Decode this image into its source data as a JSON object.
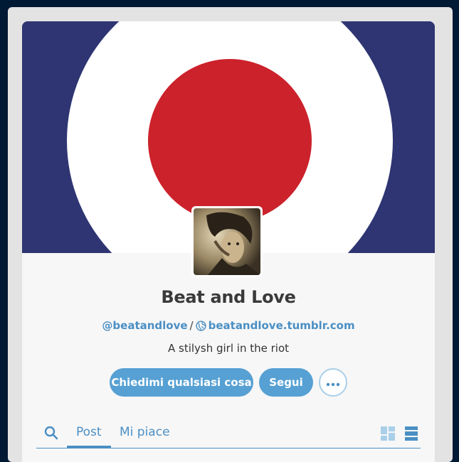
{
  "blog": {
    "title": "Beat and Love",
    "username": "@beatandlove",
    "separator": "/",
    "url": "beatandlove.tumblr.com",
    "description": "A stilysh girl in the riot"
  },
  "actions": {
    "ask_label": "Chiedimi qualsiasi cosa",
    "follow_label": "Segui",
    "more_icon": "ellipsis-icon"
  },
  "tabs": {
    "search_icon": "search-icon",
    "post_label": "Post",
    "likes_label": "Mi piace",
    "active": "Post"
  },
  "view_modes": [
    "grid-view-icon",
    "list-view-icon"
  ],
  "colors": {
    "accent": "#4a8fc4",
    "button": "#56a0d3",
    "header_blue": "#2e3572",
    "header_red": "#cc222b",
    "page_bg": "#001935"
  }
}
